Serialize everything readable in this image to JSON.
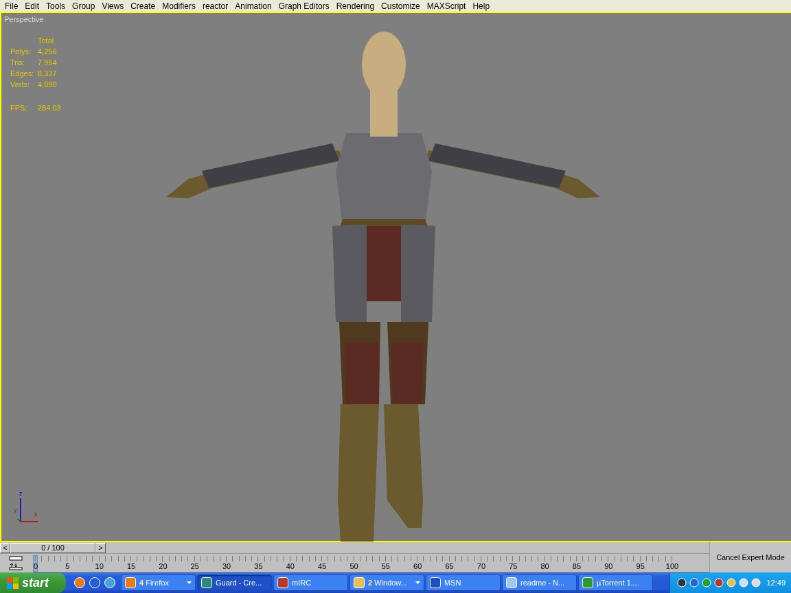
{
  "menu_bar": {
    "items": [
      "File",
      "Edit",
      "Tools",
      "Group",
      "Views",
      "Create",
      "Modifiers",
      "reactor",
      "Animation",
      "Graph Editors",
      "Rendering",
      "Customize",
      "MAXScript",
      "Help"
    ]
  },
  "viewport": {
    "label": "Perspective",
    "stats": {
      "header": "Total",
      "rows": [
        {
          "label": "Polys:",
          "value": "4,256"
        },
        {
          "label": "Tris:",
          "value": "7,954"
        },
        {
          "label": "Edges:",
          "value": "8,337"
        },
        {
          "label": "Verts:",
          "value": "4,090"
        }
      ],
      "fps_label": "FPS:",
      "fps_value": "284.03"
    },
    "axes": {
      "z": "z",
      "y": "y",
      "x": "x"
    }
  },
  "time_slider": {
    "prev": "<",
    "position": "0 / 100",
    "next": ">",
    "ticks": [
      "0",
      "5",
      "10",
      "15",
      "20",
      "25",
      "30",
      "35",
      "40",
      "45",
      "50",
      "55",
      "60",
      "65",
      "70",
      "75",
      "80",
      "85",
      "90",
      "95",
      "100"
    ]
  },
  "expert_mode_button": "Cancel Expert Mode",
  "taskbar": {
    "start": "start",
    "tasks": [
      {
        "kind": "group",
        "count": "4",
        "label": "Firefox",
        "selected": false
      },
      {
        "kind": "window",
        "label": "Guard - Cre...",
        "selected": true
      },
      {
        "kind": "window",
        "label": "mIRC",
        "selected": false
      },
      {
        "kind": "group",
        "count": "2",
        "label": "Window...",
        "selected": false
      },
      {
        "kind": "window",
        "label": "MSN",
        "selected": false
      },
      {
        "kind": "window",
        "label": "readme - N...",
        "selected": false
      },
      {
        "kind": "window",
        "label": "µTorrent 1....",
        "selected": false
      }
    ],
    "clock": "12:49"
  }
}
